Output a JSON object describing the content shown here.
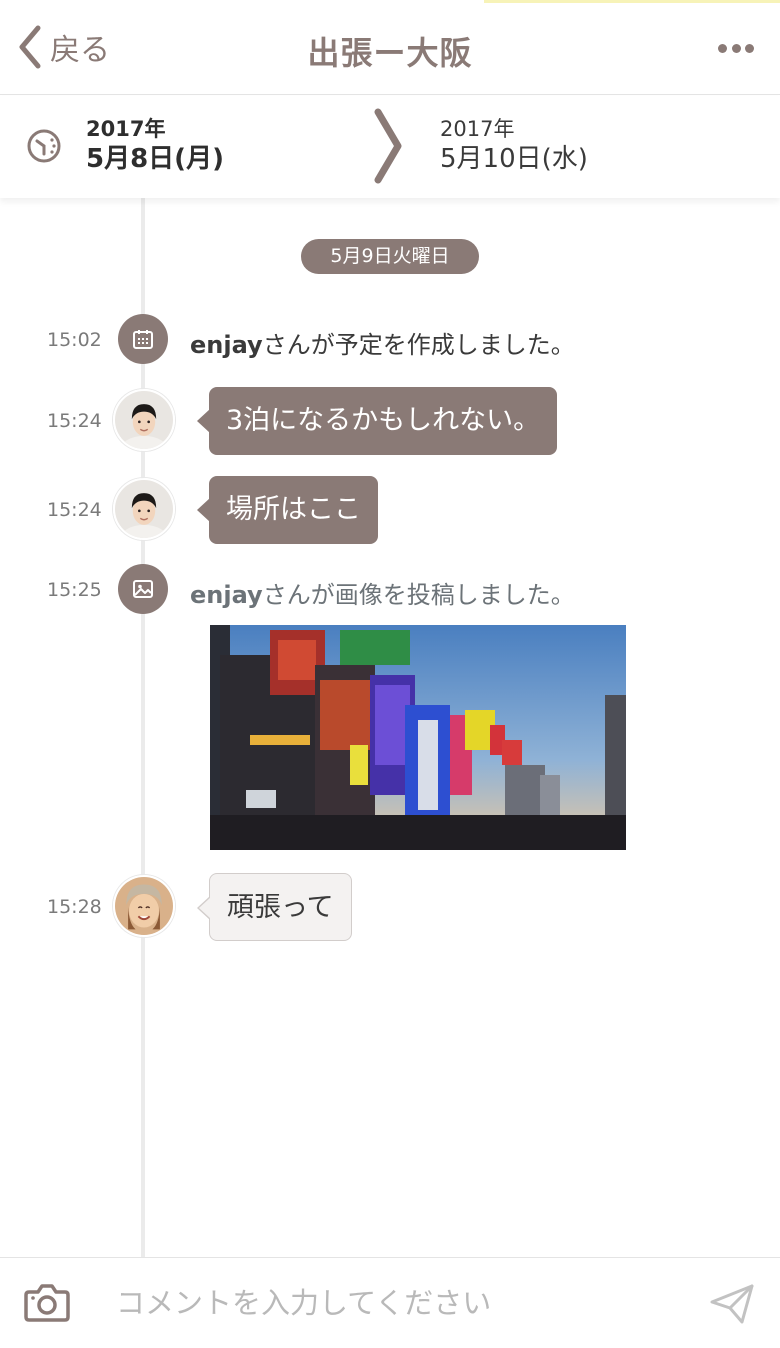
{
  "header": {
    "back_label": "戻る",
    "title": "出張ー大阪"
  },
  "date_range": {
    "start_year": "2017年",
    "start_day": "5月8日(月)",
    "end_year": "2017年",
    "end_day": "5月10日(水)"
  },
  "timeline": {
    "day_label": "5月9日火曜日",
    "entries": [
      {
        "time": "15:02",
        "type": "event",
        "icon": "calendar-icon",
        "user": "enjay",
        "text": "さんが予定を作成しました。"
      },
      {
        "time": "15:24",
        "type": "message",
        "sender": "self",
        "text": "3泊になるかもしれない。"
      },
      {
        "time": "15:24",
        "type": "message",
        "sender": "self",
        "text": "場所はここ"
      },
      {
        "time": "15:25",
        "type": "event",
        "icon": "image-icon",
        "user": "enjay",
        "text": "さんが画像を投稿しました。"
      },
      {
        "time": "15:28",
        "type": "message",
        "sender": "other",
        "text": "頑張って"
      }
    ]
  },
  "composer": {
    "placeholder": "コメントを入力してください"
  },
  "colors": {
    "accent": "#8a7a76",
    "bubble_other": "#f4f2f1",
    "timeline_line": "#ebebeb"
  }
}
